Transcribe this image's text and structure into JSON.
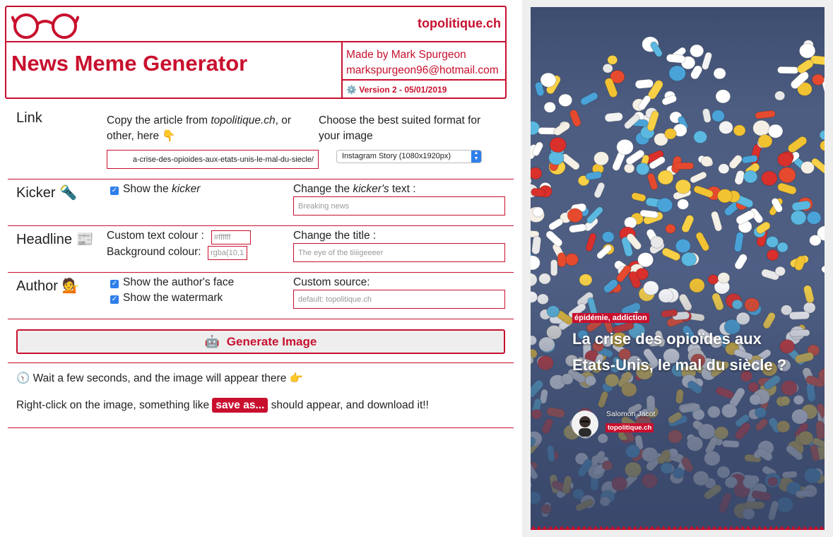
{
  "header": {
    "site_name": "topolitique.ch",
    "title": "News Meme Generator",
    "made_by": "Made by Mark Spurgeon",
    "email": "markspurgeon96@hotmail.com",
    "version": "Version 2 - 05/01/2019"
  },
  "link": {
    "label": "Link",
    "copy_prefix": "Copy the article from ",
    "copy_site": "topolitique.ch",
    "copy_suffix": ", or other, here 👇",
    "url_value": "a-crise-des-opioides-aux-etats-unis-le-mal-du-siecle/",
    "format_hint": "Choose the best suited format for your image",
    "format_selected": "Instagram Story (1080x1920px)"
  },
  "kicker": {
    "label": "Kicker 🔦",
    "show_prefix": "Show the ",
    "show_em": "kicker",
    "show_checked": true,
    "change_prefix": "Change the ",
    "change_em": "kicker's",
    "change_suffix": " text :",
    "placeholder": "Breaking news"
  },
  "headline": {
    "label": "Headline 📰",
    "text_colour_label": "Custom text colour :",
    "text_colour_placeholder": "#ffffff",
    "bg_colour_label": "Background colour:",
    "bg_colour_placeholder": "rgba(10,1",
    "change_title_label": "Change the title :",
    "title_placeholder": "The eye of the tiiiigeeeer"
  },
  "author": {
    "label": "Author 💁",
    "show_face_label": "Show the author's face",
    "show_face_checked": true,
    "show_watermark_label": "Show the watermark",
    "show_watermark_checked": true,
    "custom_source_label": "Custom source:",
    "source_placeholder": "default: topolitique.ch"
  },
  "generate": {
    "icon": "🤖",
    "label": "Generate Image"
  },
  "footer": {
    "wait_text": "🕥 Wait a few seconds, and the image will appear there 👉",
    "right_click_prefix": "Right-click on the image, something like ",
    "save_as": "save as...",
    "right_click_suffix": " should appear, and download it!!"
  },
  "preview": {
    "kicker": "épidémie, addiction",
    "headline": "La crise des opioïdes aux Etats-Unis, le mal du siècle ?",
    "author_name": "Salomon Jacot",
    "source": "topolitique.ch"
  },
  "colors": {
    "accent": "#c8102e",
    "checkbox": "#2f7fea",
    "panel_bg": "#efefef"
  }
}
